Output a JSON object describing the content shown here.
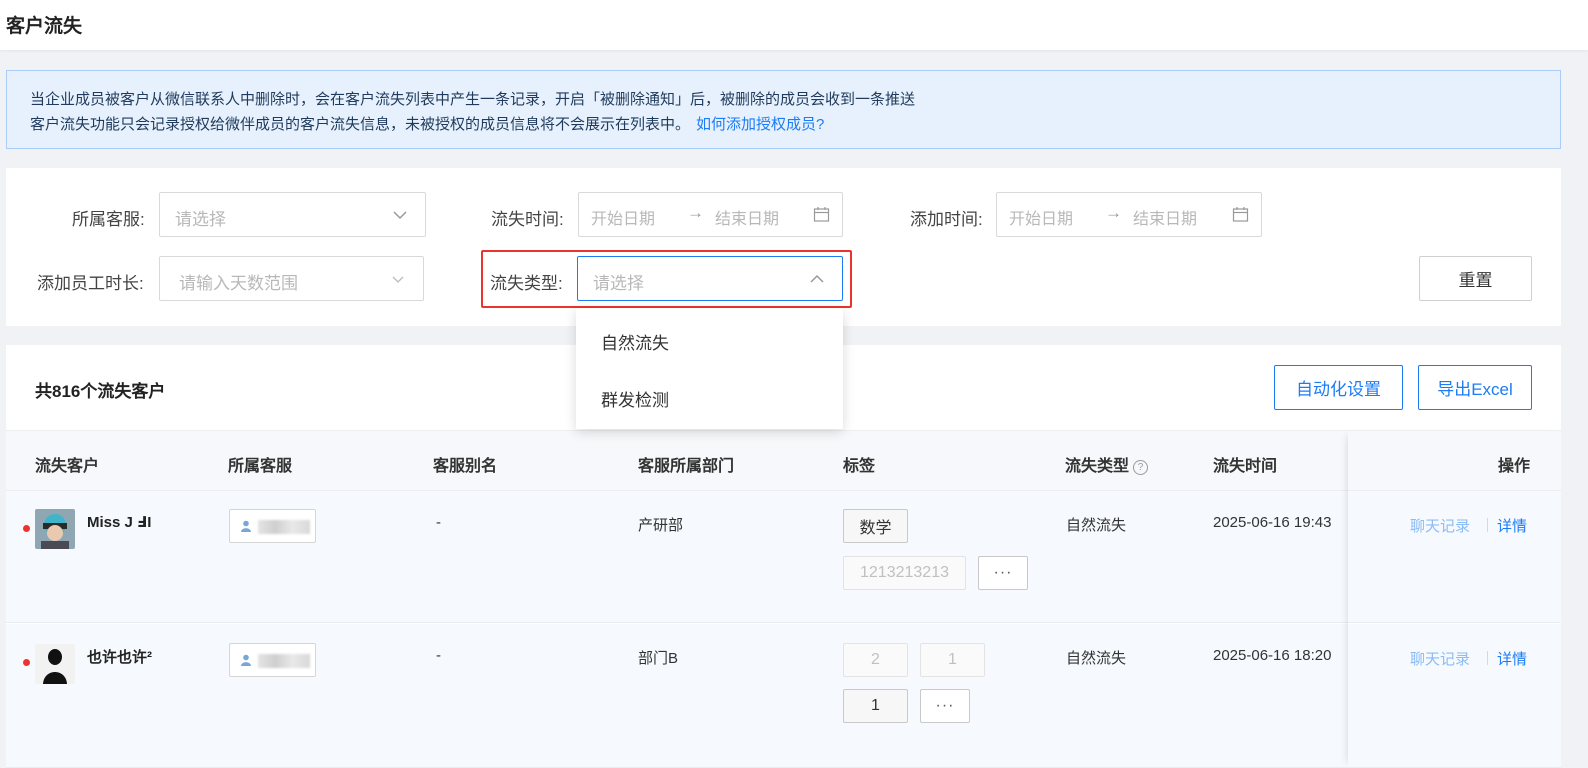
{
  "page": {
    "title": "客户流失"
  },
  "notice": {
    "line1": "当企业成员被客户从微信联系人中删除时，会在客户流失列表中产生一条记录，开启「被删除通知」后，被删除的成员会收到一条推送",
    "line2": "客户流失功能只会记录授权给微伴成员的客户流失信息，未被授权的成员信息将不会展示在列表中。",
    "link": "如何添加授权成员?"
  },
  "filters": {
    "staff": {
      "label": "所属客服:",
      "placeholder": "请选择"
    },
    "churn_time": {
      "label": "流失时间:",
      "start": "开始日期",
      "end": "结束日期"
    },
    "add_time": {
      "label": "添加时间:",
      "start": "开始日期",
      "end": "结束日期"
    },
    "duration": {
      "label": "添加员工时长:",
      "placeholder": "请输入天数范围"
    },
    "churn_type": {
      "label": "流失类型:",
      "placeholder": "请选择",
      "options": [
        "自然流失",
        "群发检测"
      ]
    },
    "reset_label": "重置",
    "arrow": "→"
  },
  "table": {
    "count_text": "共816个流失客户",
    "auto_settings": "自动化设置",
    "export": "导出Excel",
    "columns": [
      "流失客户",
      "所属客服",
      "客服别名",
      "客服所属部门",
      "标签",
      "流失类型",
      "流失时间",
      "操作"
    ],
    "help_icon": "?",
    "rows": [
      {
        "name": "Miss J ℲI",
        "alias": "-",
        "dept": "产研部",
        "tags": [
          "数学",
          "1213213213"
        ],
        "more": "···",
        "type": "自然流失",
        "time": "2025-06-16 19:43",
        "op_chat": "聊天记录",
        "op_detail": "详情"
      },
      {
        "name": "也许也许²",
        "alias": "-",
        "dept": "部门B",
        "tags": [
          "2",
          "1",
          "1"
        ],
        "more": "···",
        "type": "自然流失",
        "time": "2025-06-16 18:20",
        "op_chat": "聊天记录",
        "op_detail": "详情"
      }
    ]
  },
  "colors": {
    "accent": "#1c7cf5",
    "highlight": "#e8352d",
    "notice_bg": "#e6f1fd"
  }
}
